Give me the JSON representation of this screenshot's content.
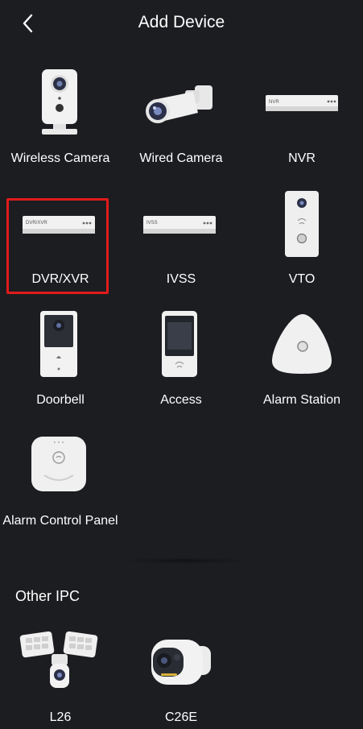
{
  "header": {
    "title": "Add Device"
  },
  "devices": [
    {
      "label": "Wireless Camera",
      "icon": "wireless-camera-icon"
    },
    {
      "label": "Wired Camera",
      "icon": "wired-camera-icon"
    },
    {
      "label": "NVR",
      "icon": "nvr-icon",
      "printed_text": "NVR"
    },
    {
      "label": "DVR/XVR",
      "icon": "dvr-xvr-icon",
      "printed_text": "DVR/XVR",
      "selected": true
    },
    {
      "label": "IVSS",
      "icon": "ivss-icon",
      "printed_text": "IVSS"
    },
    {
      "label": "VTO",
      "icon": "vto-icon"
    },
    {
      "label": "Doorbell",
      "icon": "doorbell-icon"
    },
    {
      "label": "Access",
      "icon": "access-control-icon"
    },
    {
      "label": "Alarm Station",
      "icon": "alarm-station-icon"
    },
    {
      "label": "Alarm Control Panel",
      "icon": "alarm-control-panel-icon"
    }
  ],
  "other_ipc": {
    "title": "Other IPC",
    "items": [
      {
        "label": "L26",
        "icon": "floodlight-camera-icon"
      },
      {
        "label": "C26E",
        "icon": "bullet-camera-icon"
      }
    ]
  },
  "colors": {
    "background": "#1c1d21",
    "text": "#ffffff",
    "selection_border": "#e01b1b"
  }
}
